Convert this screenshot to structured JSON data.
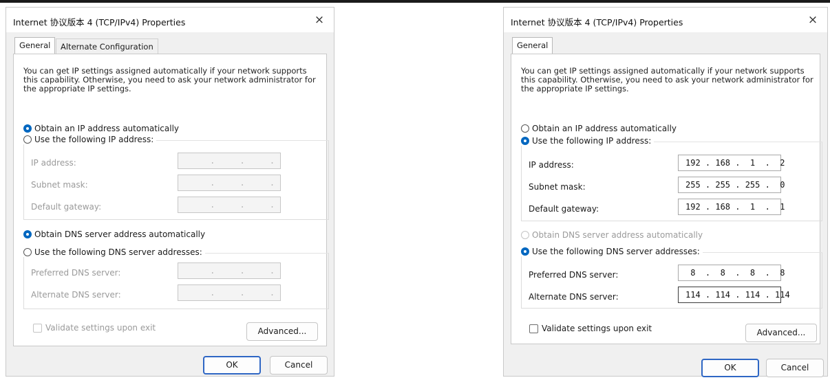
{
  "left": {
    "title": "Internet 协议版本 4 (TCP/IPv4) Properties",
    "tabs": [
      "General",
      "Alternate Configuration"
    ],
    "intro": "You can get IP settings assigned automatically if your network supports this capability. Otherwise, you need to ask your network administrator for the appropriate IP settings.",
    "ip_auto": "Obtain an IP address automatically",
    "ip_manual": "Use the following IP address:",
    "ip_label": "IP address:",
    "mask_label": "Subnet mask:",
    "gw_label": "Default gateway:",
    "dns_auto": "Obtain DNS server address automatically",
    "dns_manual": "Use the following DNS server addresses:",
    "pref_label": "Preferred DNS server:",
    "alt_label": "Alternate DNS server:",
    "empty_ip": "     .     .     .",
    "validate": "Validate settings upon exit",
    "advanced": "Advanced...",
    "ok": "OK",
    "cancel": "Cancel"
  },
  "right": {
    "title": "Internet 协议版本 4 (TCP/IPv4) Properties",
    "tabs": [
      "General"
    ],
    "intro": "You can get IP settings assigned automatically if your network supports this capability. Otherwise, you need to ask your network administrator for the appropriate IP settings.",
    "ip_auto": "Obtain an IP address automatically",
    "ip_manual": "Use the following IP address:",
    "ip_label": "IP address:",
    "ip_value": "192 . 168 .  1  .  2",
    "mask_label": "Subnet mask:",
    "mask_value": "255 . 255 . 255 .  0",
    "gw_label": "Default gateway:",
    "gw_value": "192 . 168 .  1  .  1",
    "dns_auto": "Obtain DNS server address automatically",
    "dns_manual": "Use the following DNS server addresses:",
    "pref_label": "Preferred DNS server:",
    "pref_value": " 8  .  8  .  8  .  8",
    "alt_label": "Alternate DNS server:",
    "alt_value": "114 . 114 . 114 . 114",
    "validate": "Validate settings upon exit",
    "advanced": "Advanced...",
    "ok": "OK",
    "cancel": "Cancel"
  },
  "icons": {
    "close": "×"
  },
  "colors": {
    "radio_selected": "#0067c0",
    "primary_border": "#2e66c4"
  }
}
